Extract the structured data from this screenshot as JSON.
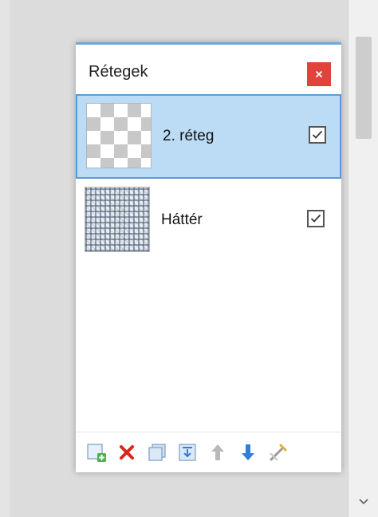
{
  "layers_panel": {
    "title": "Rétegek",
    "close_icon": "close-icon",
    "layers": [
      {
        "name": "2. réteg",
        "selected": true,
        "visible": true,
        "thumbnail": "transparent-checker"
      },
      {
        "name": "Háttér",
        "selected": false,
        "visible": true,
        "thumbnail": "texture-pattern"
      }
    ],
    "toolbar": [
      "add-layer-icon",
      "delete-layer-icon",
      "duplicate-layer-icon",
      "merge-layer-down-icon",
      "move-layer-up-icon",
      "move-layer-down-icon",
      "layer-properties-icon"
    ]
  },
  "colors": {
    "selected_background": "#bcdcf6",
    "selected_border": "#5b9bd5",
    "close_button": "#e0433b",
    "delete_icon": "#d9261c",
    "arrow_blue": "#2f7fd6"
  }
}
